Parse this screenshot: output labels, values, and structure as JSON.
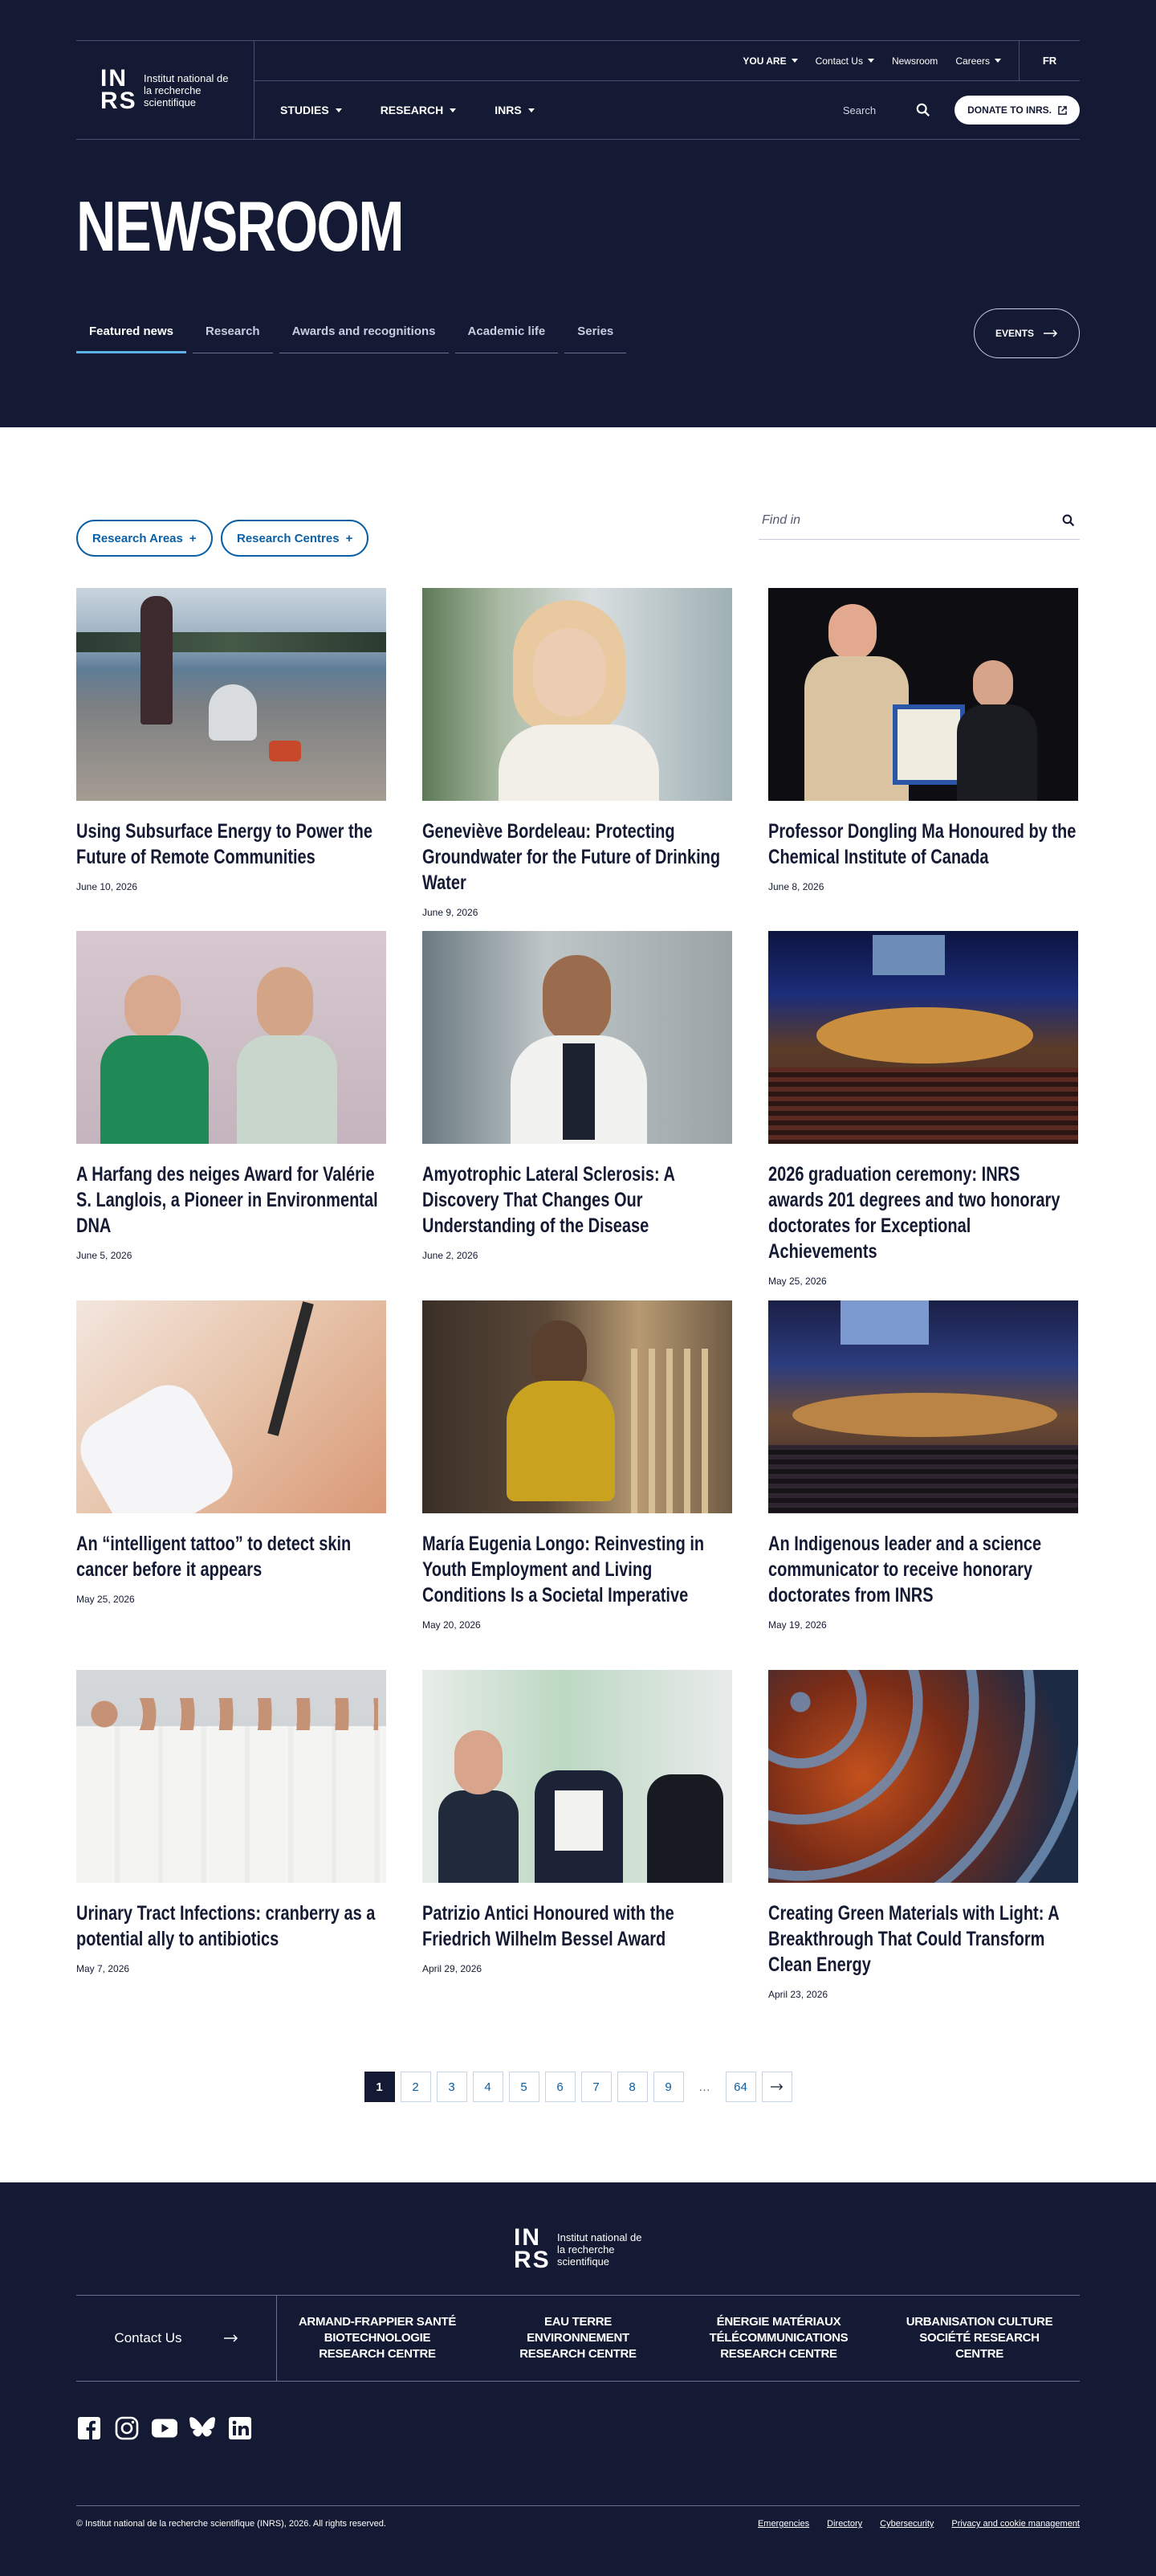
{
  "header": {
    "logo_text": "Institut national de la recherche scientifique",
    "logo_mark": "INRS",
    "utility_nav": [
      {
        "label": "YOU ARE",
        "dropdown": true
      },
      {
        "label": "Contact Us",
        "dropdown": true
      },
      {
        "label": "Newsroom",
        "dropdown": false
      },
      {
        "label": "Careers",
        "dropdown": true
      }
    ],
    "lang": "FR",
    "main_nav": [
      {
        "label": "STUDIES"
      },
      {
        "label": "RESEARCH"
      },
      {
        "label": "INRS"
      }
    ],
    "search_label": "Search",
    "donate_label": "DONATE TO INRS."
  },
  "hero": {
    "title": "NEWSROOM",
    "tabs": [
      "Featured news",
      "Research",
      "Awards and recognitions",
      "Academic life",
      "Series"
    ],
    "active_tab": 0,
    "events_label": "EVENTS"
  },
  "filters": {
    "research_areas": "Research Areas",
    "research_centres": "Research Centres",
    "find_placeholder": "Find in"
  },
  "articles": [
    {
      "title": "Using Subsurface Energy to Power the Future of Remote Communities",
      "date": "June 10, 2026"
    },
    {
      "title": "Geneviève Bordeleau: Protecting Groundwater for the Future of Drinking Water",
      "date": "June 9, 2026"
    },
    {
      "title": "Professor Dongling Ma Honoured by the Chemical Institute of Canada",
      "date": "June 8, 2026"
    },
    {
      "title": "A Harfang des neiges Award for Valérie S. Langlois, a Pioneer in Environmental DNA",
      "date": "June 5, 2026"
    },
    {
      "title": "Amyotrophic Lateral Sclerosis: A Discovery That Changes Our Understanding of the Disease",
      "date": "June 2, 2026"
    },
    {
      "title": "2026 graduation ceremony: INRS awards 201 degrees and two honorary doctorates for Exceptional Achievements",
      "date": "May 25, 2026"
    },
    {
      "title": "An “intelligent tattoo” to detect skin cancer before it appears",
      "date": "May 25, 2026"
    },
    {
      "title": "María Eugenia Longo: Reinvesting in Youth Employment and Living Conditions Is a Societal Imperative",
      "date": "May 20, 2026"
    },
    {
      "title": "An Indigenous leader and a science communicator to receive honorary doctorates from INRS",
      "date": "May 19, 2026"
    },
    {
      "title": "Urinary Tract Infections: cranberry as a potential ally to antibiotics",
      "date": "May 7, 2026"
    },
    {
      "title": "Patrizio Antici Honoured with the Friedrich Wilhelm Bessel Award",
      "date": "April 29, 2026"
    },
    {
      "title": "Creating Green Materials with Light: A Breakthrough That Could Transform Clean Energy",
      "date": "April 23, 2026"
    }
  ],
  "pagination": {
    "pages": [
      "1",
      "2",
      "3",
      "4",
      "5",
      "6",
      "7",
      "8",
      "9",
      "…",
      "64"
    ],
    "current": "1"
  },
  "footer": {
    "logo_text": "Institut national de la recherche scientifique",
    "logo_mark": "INRS",
    "contact_label": "Contact Us",
    "centres": [
      "ARMAND-FRAPPIER SANTÉ BIOTECHNOLOGIE RESEARCH CENTRE",
      "EAU TERRE ENVIRONNEMENT RESEARCH CENTRE",
      "ÉNERGIE MATÉRIAUX TÉLÉCOMMUNICATIONS RESEARCH CENTRE",
      "URBANISATION CULTURE SOCIÉTÉ RESEARCH CENTRE"
    ],
    "social": [
      "facebook-icon",
      "instagram-icon",
      "youtube-icon",
      "bluesky-icon",
      "linkedin-icon"
    ],
    "copyright": "© Institut national de la recherche scientifique (INRS), 2026. All rights reserved.",
    "links": [
      "Emergencies",
      "Directory",
      "Cybersecurity",
      "Privacy and cookie management"
    ]
  },
  "colors": {
    "navy": "#141a33",
    "accent_blue": "#0b5fa5",
    "tab_underline": "#5db1e8"
  }
}
